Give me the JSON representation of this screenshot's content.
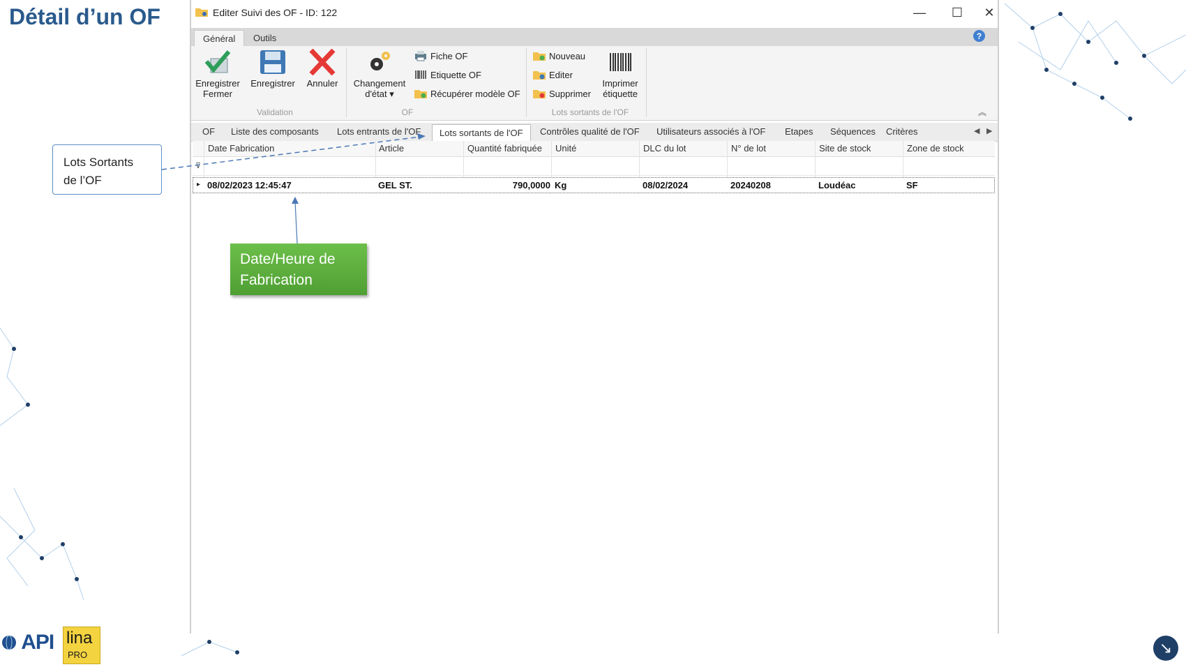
{
  "slide": {
    "title": "Détail d’un OF"
  },
  "window": {
    "title": "Editer Suivi des OF - ID: 122",
    "minimize": "—",
    "maximize": "☐",
    "close": "✕"
  },
  "ribbon": {
    "tabs": [
      {
        "label": "Général",
        "active": true
      },
      {
        "label": "Outils",
        "active": false
      }
    ],
    "help": "?",
    "collapse": "︽",
    "groups": {
      "validation": {
        "label": "Validation",
        "buttons": [
          {
            "label": "Enregistrer\nFermer",
            "icon": "save-close-check-icon",
            "color": "#2f9e5a"
          },
          {
            "label": "Enregistrer",
            "icon": "floppy-disk-icon",
            "color": "#3f78b5"
          },
          {
            "label": "Annuler",
            "icon": "red-x-icon",
            "color": "#e53935"
          }
        ]
      },
      "of": {
        "label": "OF",
        "big_button": {
          "label": "Changement\nd'état ▾",
          "icon": "gears-icon"
        },
        "small_buttons": [
          {
            "label": "Fiche OF",
            "icon": "printer-icon"
          },
          {
            "label": "Etiquette OF",
            "icon": "barcode-icon"
          },
          {
            "label": "Récupérer modèle OF",
            "icon": "folder-add-icon"
          }
        ]
      },
      "lots": {
        "label": "Lots sortants de l'OF",
        "small_buttons": [
          {
            "label": "Nouveau",
            "icon": "folder-new-icon"
          },
          {
            "label": "Editer",
            "icon": "folder-edit-icon"
          },
          {
            "label": "Supprimer",
            "icon": "folder-delete-icon"
          }
        ],
        "big_button": {
          "label": "Imprimer\nétiquette",
          "icon": "barcode-print-icon"
        }
      }
    }
  },
  "tabs": [
    {
      "label": "OF",
      "active": false
    },
    {
      "label": "Liste des composants",
      "active": false
    },
    {
      "label": "Lots entrants de l'OF",
      "active": false
    },
    {
      "label": "Lots sortants de l'OF",
      "active": true
    },
    {
      "label": "Contrôles qualité de l'OF",
      "active": false
    },
    {
      "label": "Utilisateurs associés à l'OF",
      "active": false
    },
    {
      "label": "Etapes",
      "active": false
    },
    {
      "label": "Séquences",
      "active": false
    },
    {
      "label": "Critères",
      "active": false
    }
  ],
  "tab_scroll": {
    "left": "◀",
    "right": "▶"
  },
  "grid": {
    "columns": [
      "Date Fabrication",
      "Article",
      "Quantité fabriquée",
      "Unité",
      "DLC du lot",
      "N° de lot",
      "Site de stock",
      "Zone de stock"
    ],
    "rows": [
      [
        "08/02/2023 12:45:47",
        "GEL ST.",
        "790,0000",
        "Kg",
        "08/02/2024",
        "20240208",
        "Loudéac",
        "SF"
      ]
    ],
    "row_indicator": "▸",
    "filter_icon": "⊽"
  },
  "callouts": {
    "lots": "Lots Sortants\nde l’OF",
    "date": "Date/Heure de\nFabrication"
  },
  "branding": {
    "api": "API",
    "lina": "lina",
    "lina_sub": "PRO"
  },
  "nav": {
    "arrow": "↘"
  }
}
